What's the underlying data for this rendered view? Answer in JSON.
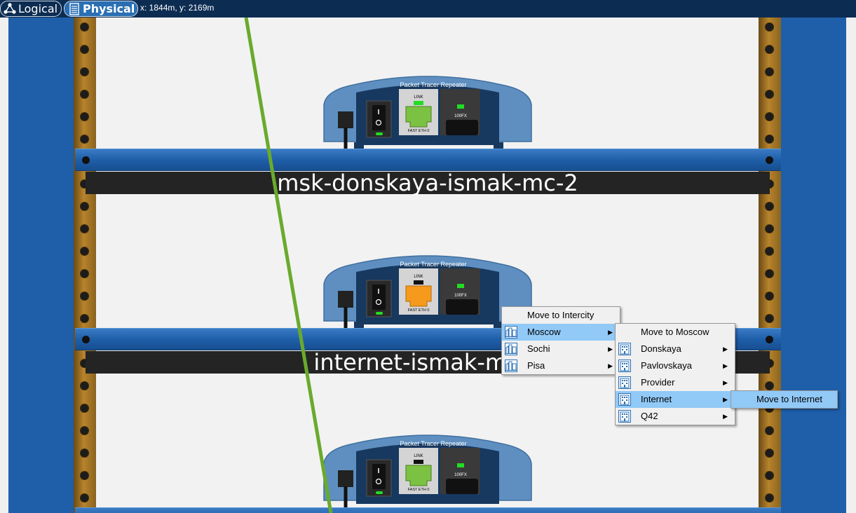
{
  "toolbar": {
    "logical_label": "Logical",
    "physical_label": "Physical",
    "coordinates": "x: 1844m, y: 2169m"
  },
  "devices": [
    {
      "brand": "Packet Tracer Repeater",
      "port_link_label": "LINK",
      "port_eth_label": "FAST ETH 0",
      "fiber_label": "100FX"
    },
    {
      "brand": "Packet Tracer Repeater",
      "port_link_label": "LINK",
      "port_eth_label": "FAST ETH 0",
      "fiber_label": "100FX"
    },
    {
      "brand": "Packet Tracer Repeater",
      "port_link_label": "LINK",
      "port_eth_label": "FAST ETH 0",
      "fiber_label": "100FX"
    }
  ],
  "rack_labels": [
    "msk-donskaya-ismak-mc-2",
    "internet-ismak-mc-1"
  ],
  "menu1": {
    "items": [
      {
        "label": "Move to Intercity",
        "icon": "",
        "has_submenu": false
      },
      {
        "label": "Moscow",
        "icon": "city-icon",
        "has_submenu": true,
        "highlighted": true
      },
      {
        "label": "Sochi",
        "icon": "city-icon",
        "has_submenu": true
      },
      {
        "label": "Pisa",
        "icon": "city-icon",
        "has_submenu": true
      }
    ]
  },
  "menu2": {
    "items": [
      {
        "label": "Move to Moscow",
        "icon": "",
        "has_submenu": false
      },
      {
        "label": "Donskaya",
        "icon": "building-icon",
        "has_submenu": true
      },
      {
        "label": "Pavlovskaya",
        "icon": "building-icon",
        "has_submenu": true
      },
      {
        "label": "Provider",
        "icon": "building-icon",
        "has_submenu": true
      },
      {
        "label": "Internet",
        "icon": "building-icon",
        "has_submenu": true,
        "highlighted": true
      },
      {
        "label": "Q42",
        "icon": "building-icon",
        "has_submenu": true
      }
    ]
  },
  "menu3": {
    "items": [
      {
        "label": "Move to Internet",
        "icon": "",
        "has_submenu": false,
        "highlighted": true
      }
    ]
  },
  "colors": {
    "toolbar_bg": "#0d2c52",
    "rack_blue": "#1f5fa9",
    "rail_brown": "#b8842c",
    "link_led_green": "#22dd22",
    "port_orange": "#f59a1c",
    "port_green": "#7cc242",
    "cable_green": "#6aaa2c",
    "menu_highlight": "#91c9f7"
  }
}
